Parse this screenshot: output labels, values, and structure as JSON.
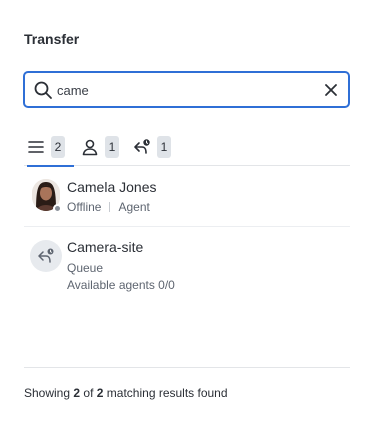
{
  "title": "Transfer",
  "search": {
    "value": "came",
    "placeholder": ""
  },
  "tabs": [
    {
      "name": "all",
      "icon": "list-icon",
      "count": "2"
    },
    {
      "name": "agents",
      "icon": "user-icon",
      "count": "1"
    },
    {
      "name": "queues",
      "icon": "queue-transfer-icon",
      "count": "1"
    }
  ],
  "results": [
    {
      "name": "Camela Jones",
      "status": "Offline",
      "type": "Agent"
    },
    {
      "name": "Camera-site",
      "type": "Queue",
      "detail": "Available agents 0/0"
    }
  ],
  "footer": {
    "prefix": "Showing",
    "shown": "2",
    "of": "of",
    "total": "2",
    "suffix": "matching results found"
  },
  "colors": {
    "accent": "#2f6fd6",
    "offline": "#8a9099",
    "badge": "#dfe3e8"
  }
}
